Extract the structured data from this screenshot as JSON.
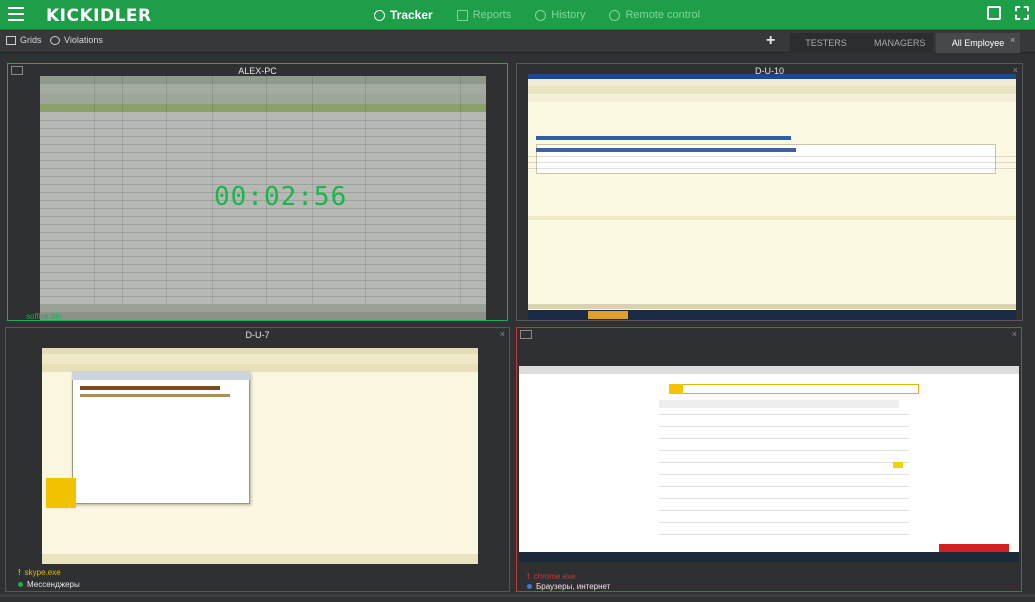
{
  "app": {
    "logo": "KICKIDLER",
    "nav": [
      {
        "label": "Tracker",
        "active": true
      },
      {
        "label": "Reports",
        "active": false
      },
      {
        "label": "History",
        "active": false
      },
      {
        "label": "Remote control",
        "active": false
      }
    ]
  },
  "toolbar": {
    "grids_label": "Grids",
    "violations_label": "Violations",
    "add_label": "+",
    "tabs": [
      {
        "label": "TESTERS",
        "active": false
      },
      {
        "label": "MANAGERS",
        "active": false
      },
      {
        "label": "All Employee",
        "active": true
      }
    ],
    "tab_close": "×"
  },
  "tiles": [
    {
      "title": "ALEX-PC",
      "timer": "00:02:56",
      "process": "soffice.bin",
      "border_color": "#1fae4f"
    },
    {
      "title": "D-U-10",
      "process": "",
      "border_color": "#55585a"
    },
    {
      "title": "D-U-7",
      "process": "skype.exe",
      "category": "Мессенджеры",
      "border_color": "#55585a"
    },
    {
      "title": "",
      "process": "chrome.exe",
      "category": "Браузеры, интернет",
      "border_color": "#c0393b"
    }
  ],
  "colors": {
    "accent": "#1f9e4a",
    "violation": "#c0393b",
    "warning": "#e6b800"
  }
}
